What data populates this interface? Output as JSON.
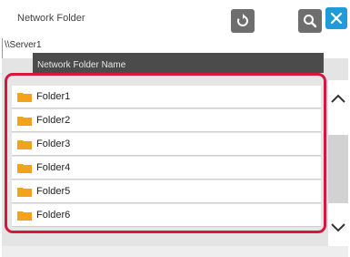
{
  "window": {
    "title": "Network Folder",
    "path": "\\\\Server1"
  },
  "toolbar": {
    "refresh_icon": "refresh-icon",
    "search_icon": "search-icon",
    "close_icon": "close-icon"
  },
  "list": {
    "column_header": "Network Folder Name",
    "items": [
      {
        "label": "Folder1"
      },
      {
        "label": "Folder2"
      },
      {
        "label": "Folder3"
      },
      {
        "label": "Folder4"
      },
      {
        "label": "Folder5"
      },
      {
        "label": "Folder6"
      }
    ]
  },
  "colors": {
    "accent": "#1f9bd8",
    "highlight": "#d8173c",
    "folder": "#f3a21d"
  }
}
